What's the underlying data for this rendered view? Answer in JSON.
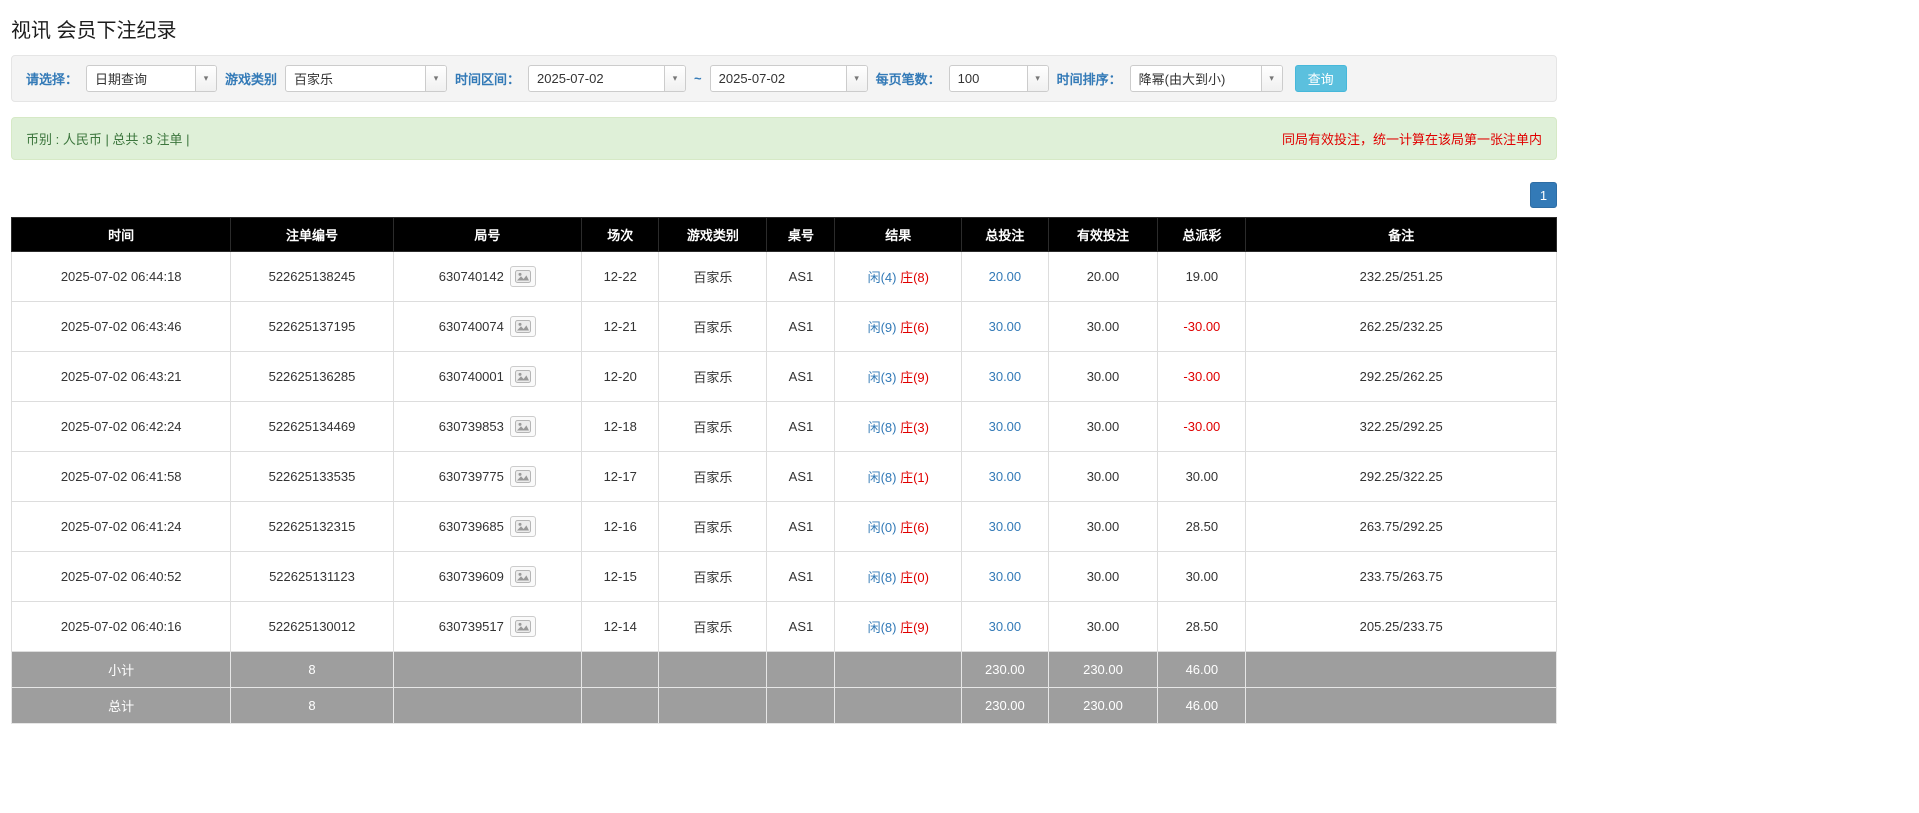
{
  "page": {
    "title": "视讯 会员下注纪录"
  },
  "colors": {
    "accent_blue": "#337ab7",
    "alert_red": "#e00000",
    "table_header_bg": "#000000",
    "table_footer_bg": "#9e9e9e",
    "info_bar_bg": "#dff0d8",
    "info_text_green": "#3c763d",
    "search_button_bg": "#5bc0de"
  },
  "filters": {
    "select_label": "请选择：",
    "select_value": "日期查询",
    "game_type_label": "游戏类别",
    "game_type_value": "百家乐",
    "time_range_label": "时间区间：",
    "date_from": "2025-07-02",
    "tilde": "~",
    "date_to": "2025-07-02",
    "page_size_label": "每页笔数：",
    "page_size_value": "100",
    "sort_label": "时间排序：",
    "sort_value": "降幂(由大到小)",
    "search_button": "查询"
  },
  "info_bar": {
    "left": "币别 : 人民币 | 总共 :8 注单 |",
    "right": "同局有效投注，统一计算在该局第一张注单内"
  },
  "pagination": {
    "current_page": "1"
  },
  "table": {
    "headers": [
      "时间",
      "注单编号",
      "局号",
      "场次",
      "游戏类别",
      "桌号",
      "结果",
      "总投注",
      "有效投注",
      "总派彩",
      "备注"
    ],
    "rows": [
      {
        "time": "2025-07-02 06:44:18",
        "bet_id": "522625138245",
        "round_id": "630740142",
        "session": "12-22",
        "game_type": "百家乐",
        "table_no": "AS1",
        "result_player": "闲(4)",
        "result_banker": "庄(8)",
        "total_bet": "20.00",
        "valid_bet": "20.00",
        "payout": "19.00",
        "remark": "232.25/251.25"
      },
      {
        "time": "2025-07-02 06:43:46",
        "bet_id": "522625137195",
        "round_id": "630740074",
        "session": "12-21",
        "game_type": "百家乐",
        "table_no": "AS1",
        "result_player": "闲(9)",
        "result_banker": "庄(6)",
        "total_bet": "30.00",
        "valid_bet": "30.00",
        "payout": "-30.00",
        "remark": "262.25/232.25"
      },
      {
        "time": "2025-07-02 06:43:21",
        "bet_id": "522625136285",
        "round_id": "630740001",
        "session": "12-20",
        "game_type": "百家乐",
        "table_no": "AS1",
        "result_player": "闲(3)",
        "result_banker": "庄(9)",
        "total_bet": "30.00",
        "valid_bet": "30.00",
        "payout": "-30.00",
        "remark": "292.25/262.25"
      },
      {
        "time": "2025-07-02 06:42:24",
        "bet_id": "522625134469",
        "round_id": "630739853",
        "session": "12-18",
        "game_type": "百家乐",
        "table_no": "AS1",
        "result_player": "闲(8)",
        "result_banker": "庄(3)",
        "total_bet": "30.00",
        "valid_bet": "30.00",
        "payout": "-30.00",
        "remark": "322.25/292.25"
      },
      {
        "time": "2025-07-02 06:41:58",
        "bet_id": "522625133535",
        "round_id": "630739775",
        "session": "12-17",
        "game_type": "百家乐",
        "table_no": "AS1",
        "result_player": "闲(8)",
        "result_banker": "庄(1)",
        "total_bet": "30.00",
        "valid_bet": "30.00",
        "payout": "30.00",
        "remark": "292.25/322.25"
      },
      {
        "time": "2025-07-02 06:41:24",
        "bet_id": "522625132315",
        "round_id": "630739685",
        "session": "12-16",
        "game_type": "百家乐",
        "table_no": "AS1",
        "result_player": "闲(0)",
        "result_banker": "庄(6)",
        "total_bet": "30.00",
        "valid_bet": "30.00",
        "payout": "28.50",
        "remark": "263.75/292.25"
      },
      {
        "time": "2025-07-02 06:40:52",
        "bet_id": "522625131123",
        "round_id": "630739609",
        "session": "12-15",
        "game_type": "百家乐",
        "table_no": "AS1",
        "result_player": "闲(8)",
        "result_banker": "庄(0)",
        "total_bet": "30.00",
        "valid_bet": "30.00",
        "payout": "30.00",
        "remark": "233.75/263.75"
      },
      {
        "time": "2025-07-02 06:40:16",
        "bet_id": "522625130012",
        "round_id": "630739517",
        "session": "12-14",
        "game_type": "百家乐",
        "table_no": "AS1",
        "result_player": "闲(8)",
        "result_banker": "庄(9)",
        "total_bet": "30.00",
        "valid_bet": "30.00",
        "payout": "28.50",
        "remark": "205.25/233.75"
      }
    ],
    "subtotal": {
      "label": "小计",
      "count": "8",
      "total_bet": "230.00",
      "valid_bet": "230.00",
      "payout": "46.00"
    },
    "total": {
      "label": "总计",
      "count": "8",
      "total_bet": "230.00",
      "valid_bet": "230.00",
      "payout": "46.00"
    }
  }
}
